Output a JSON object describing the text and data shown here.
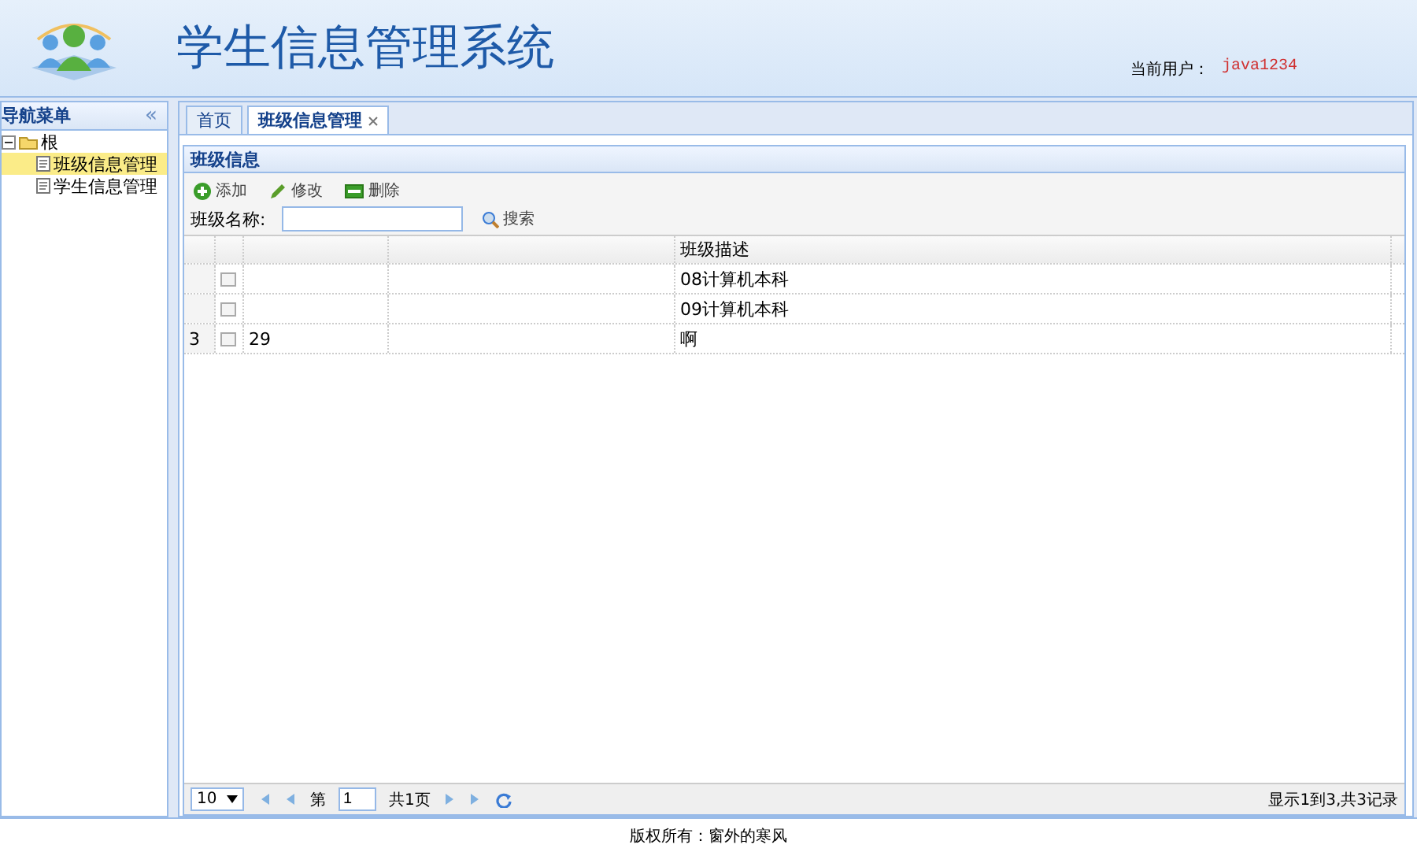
{
  "header": {
    "title": "学生信息管理系统",
    "user_label": "当前用户：",
    "user_name": "java1234"
  },
  "sidebar": {
    "title": "导航菜单",
    "collapse": "«",
    "tree": [
      {
        "label": "根",
        "expanded": true,
        "children": [
          {
            "label": "班级信息管理",
            "selected": true
          },
          {
            "label": "学生信息管理",
            "selected": false
          }
        ]
      }
    ]
  },
  "tabs": [
    {
      "label": "首页",
      "selected": false,
      "closable": false
    },
    {
      "label": "班级信息管理",
      "selected": true,
      "closable": true
    }
  ],
  "panel": {
    "title": "班级信息",
    "toolbar": [
      {
        "kind": "add",
        "label": "添加"
      },
      {
        "kind": "edit",
        "label": "修改"
      },
      {
        "kind": "delete",
        "label": "删除"
      }
    ],
    "search": {
      "label": "班级名称:",
      "button": "搜索"
    },
    "table": {
      "columns": [
        "班级描述"
      ],
      "rows": [
        {
          "selected": false,
          "description": "08计算机本科"
        },
        {
          "selected": false,
          "description": "09计算机本科"
        },
        {
          "number": "3",
          "selected": false,
          "id": "29",
          "description": "啊"
        }
      ]
    },
    "pager": {
      "page_size": "10",
      "page_label": "第",
      "page": "1",
      "total_pages": "共1页",
      "summary": "显示1到3,共3记录"
    }
  },
  "footer": "版权所有：窗外的寒风"
}
